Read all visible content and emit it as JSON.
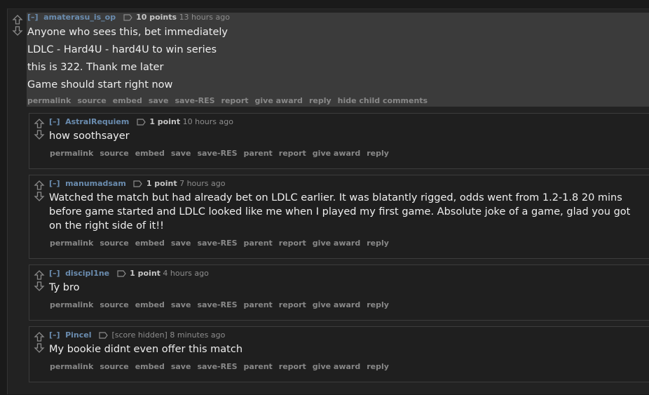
{
  "root": {
    "expand": "[–]",
    "author": "amaterasu_is_op",
    "score": "10 points",
    "time": "13 hours ago",
    "lines": [
      "Anyone who sees this, bet immediately",
      "LDLC - Hard4U - hard4U to win series",
      "this is 322. Thank me later",
      "Game should start right now"
    ],
    "actions": [
      "permalink",
      "source",
      "embed",
      "save",
      "save-RES",
      "report",
      "give award",
      "reply",
      "hide child comments"
    ]
  },
  "children": [
    {
      "expand": "[–]",
      "author": "AstralRequiem",
      "score": "1 point",
      "time": "10 hours ago",
      "text": "how soothsayer",
      "actions": [
        "permalink",
        "source",
        "embed",
        "save",
        "save-RES",
        "parent",
        "report",
        "give award",
        "reply"
      ]
    },
    {
      "expand": "[–]",
      "author": "manumadsam",
      "score": "1 point",
      "time": "7 hours ago",
      "text": "Watched the match but had already bet on LDLC earlier. It was blatantly rigged, odds went from 1.2-1.8 20 mins before game started and LDLC looked like me when I played my first game. Absolute joke of a game, glad you got on the right side of it!!",
      "actions": [
        "permalink",
        "source",
        "embed",
        "save",
        "save-RES",
        "parent",
        "report",
        "give award",
        "reply"
      ]
    },
    {
      "expand": "[–]",
      "author": "discipl1ne",
      "score": "1 point",
      "time": "4 hours ago",
      "text": "Ty bro",
      "actions": [
        "permalink",
        "source",
        "embed",
        "save",
        "save-RES",
        "parent",
        "report",
        "give award",
        "reply"
      ]
    },
    {
      "expand": "[–]",
      "author": "Pincel",
      "score": "[score hidden]",
      "time": "8 minutes ago",
      "text": "My bookie didnt even offer this match",
      "actions": [
        "permalink",
        "source",
        "embed",
        "save",
        "save-RES",
        "parent",
        "report",
        "give award",
        "reply"
      ]
    }
  ],
  "colors": {
    "author": "#6a8caf",
    "background": "#222222",
    "highlight": "#3b3b3b",
    "text": "#eeeeee"
  }
}
